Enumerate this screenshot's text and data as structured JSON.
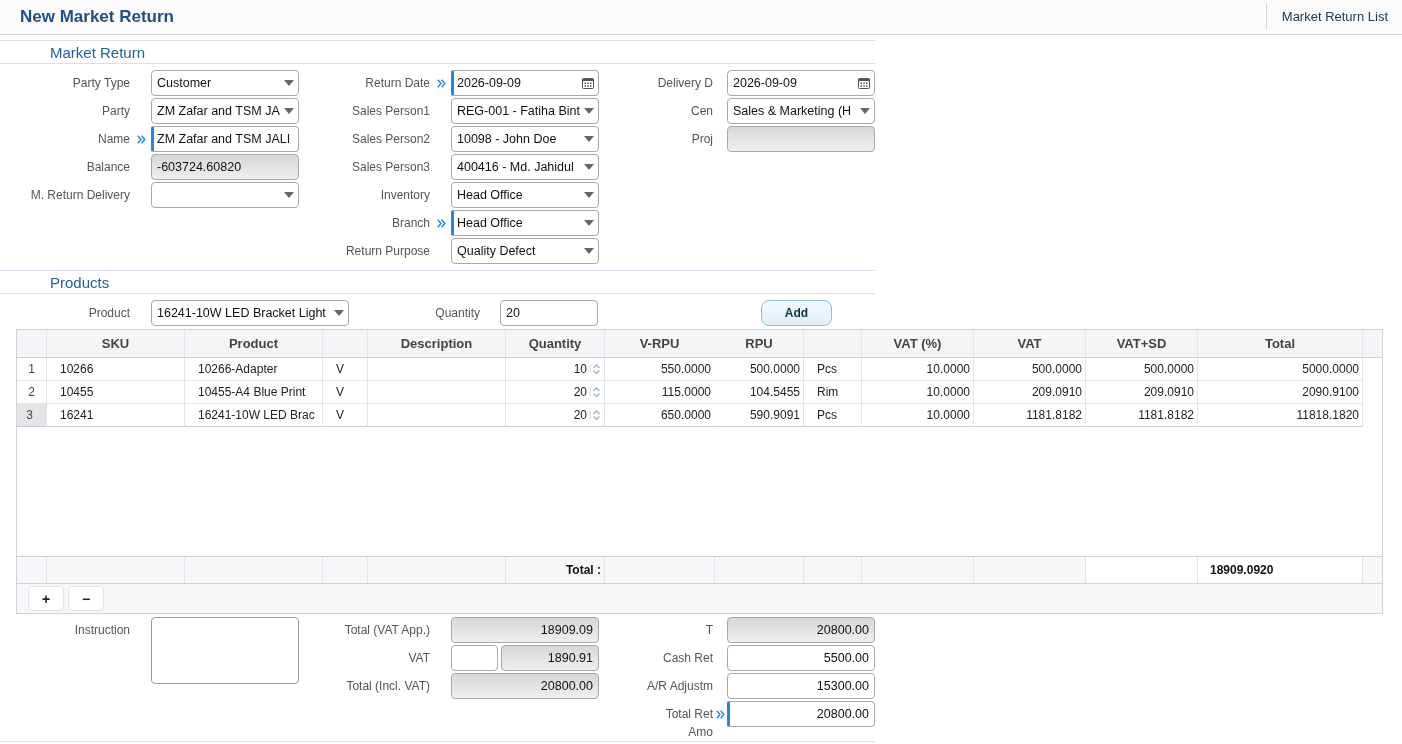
{
  "header": {
    "title": "New Market Return",
    "list_link": "Market Return List"
  },
  "market_return": {
    "title": "Market Return",
    "columns": [
      [
        {
          "label": "Party Type",
          "kind": "select",
          "value": "Customer",
          "required": false
        },
        {
          "label": "Party",
          "kind": "select",
          "value": "ZM Zafar and TSM JA",
          "required": false
        },
        {
          "label": "Name",
          "kind": "text",
          "value": "ZM Zafar and TSM JALI",
          "required": true
        },
        {
          "label": "Balance",
          "kind": "readonly",
          "value": "-603724.60820",
          "required": false
        },
        {
          "label": "M. Return Delivery",
          "kind": "select",
          "required": false
        }
      ],
      [
        {
          "label": "Return Date",
          "kind": "date",
          "value": "2026-09-09",
          "required": true
        },
        {
          "label": "Sales Person1",
          "kind": "select",
          "value": "REG-001 - Fatiha Bint",
          "required": false
        },
        {
          "label": "Sales Person2",
          "kind": "select",
          "value": "10098 - John Doe",
          "required": false
        },
        {
          "label": "Sales Person3",
          "kind": "select",
          "value": "400416 - Md. Jahidul",
          "required": false
        },
        {
          "label": "Inventory",
          "kind": "select",
          "value": "Head Office",
          "required": false
        },
        {
          "label": "Branch",
          "kind": "select",
          "value": "Head Office",
          "required": true
        },
        {
          "label": "Return Purpose",
          "kind": "select",
          "value": "Quality Defect",
          "required": false
        }
      ],
      [
        {
          "label": "Delivery D",
          "kind": "date",
          "value": "2026-09-09",
          "required": false
        },
        {
          "label": "Cen",
          "kind": "select",
          "value": "Sales & Marketing (H",
          "required": false
        },
        {
          "label": "Proj",
          "kind": "readonly",
          "required": false
        }
      ]
    ]
  },
  "products": {
    "title": "Products",
    "product": {
      "label": "Product",
      "value": "16241-10W LED Bracket Light"
    },
    "quantity": {
      "label": "Quantity",
      "value": "20"
    },
    "add_button": "Add"
  },
  "grid": {
    "columns": {
      "sku": "SKU",
      "product": "Product",
      "description": "Description",
      "quantity": "Quantity",
      "v_rpu": "V-RPU",
      "rpu": "RPU",
      "vat_pct": "VAT (%)",
      "vat": "VAT",
      "vat_sd": "VAT+SD",
      "total": "Total"
    },
    "rows": [
      {
        "number": "1",
        "selected": false,
        "sku": "10266",
        "product": "10266-Adapter",
        "column_3": "V",
        "quantity": "10",
        "v_rpu": "550.0000",
        "rpu": "500.0000",
        "column_8": "Pcs",
        "vat_pct": "10.0000",
        "vat": "500.0000",
        "vat_sd": "500.0000",
        "total": "5000.0000"
      },
      {
        "number": "2",
        "selected": false,
        "sku": "10455",
        "product": "10455-A4 Blue Print",
        "column_3": "V",
        "quantity": "20",
        "v_rpu": "115.0000",
        "rpu": "104.5455",
        "column_8": "Rim",
        "vat_pct": "10.0000",
        "vat": "209.0910",
        "vat_sd": "209.0910",
        "total": "2090.9100"
      },
      {
        "number": "3",
        "selected": true,
        "sku": "16241",
        "product": "16241-10W LED Brac",
        "column_3": "V",
        "quantity": "20",
        "v_rpu": "650.0000",
        "rpu": "590.9091",
        "column_8": "Pcs",
        "vat_pct": "10.0000",
        "vat": "1181.8182",
        "vat_sd": "1181.8182",
        "total": "11818.1820"
      }
    ],
    "footer": {
      "label": "Total :",
      "total": "18909.0920"
    },
    "row_buttons": [
      "+",
      "−"
    ]
  },
  "summary": {
    "columns": [
      [
        {
          "label": "Instruction",
          "kind": "textarea",
          "required": false
        }
      ],
      [
        {
          "label": "Total (VAT App.)",
          "kind": "readonly_amount",
          "value": "18909.09",
          "required": false
        },
        {
          "label": "VAT",
          "kind": "split_amount",
          "value": "1890.91",
          "required": false
        },
        {
          "label": "Total (Incl. VAT)",
          "kind": "readonly_amount",
          "value": "20800.00",
          "required": false
        }
      ],
      [
        {
          "label": "T",
          "kind": "readonly_amount",
          "value": "20800.00",
          "required": false
        },
        {
          "label": "Cash Ret",
          "kind": "amount",
          "value": "5500.00",
          "required": false
        },
        {
          "label": "A/R Adjustm",
          "kind": "amount",
          "value": "15300.00",
          "required": false
        },
        {
          "label": "Total Ret\nAmo",
          "kind": "amount",
          "value": "20800.00",
          "required": true
        }
      ]
    ]
  }
}
